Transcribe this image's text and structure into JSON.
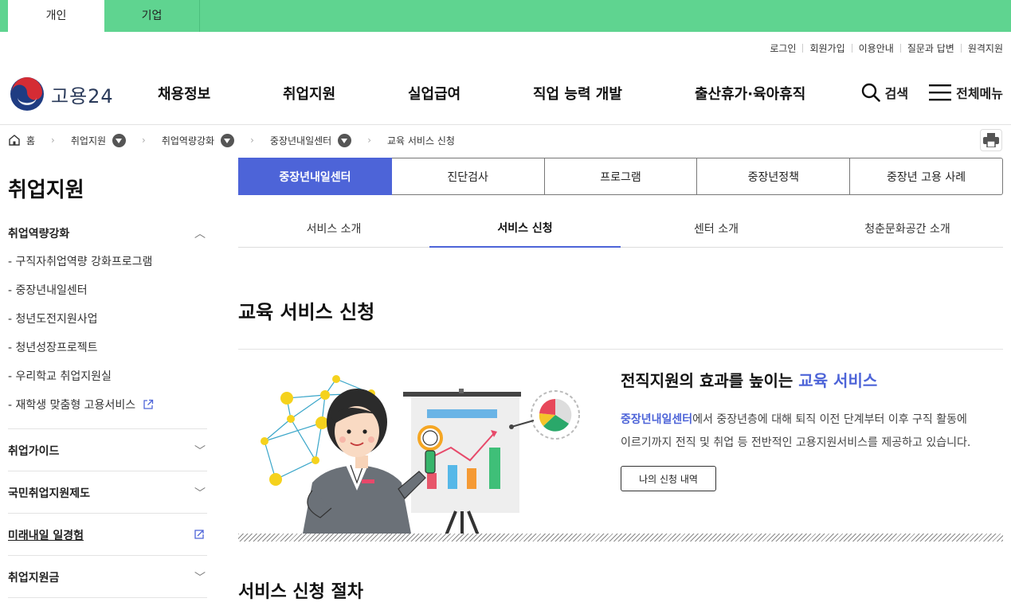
{
  "topbar": {
    "tabs": [
      "개인",
      "기업"
    ]
  },
  "util_links": [
    "로그인",
    "회원가입",
    "이용안내",
    "질문과 답변",
    "원격지원"
  ],
  "logo": {
    "text": "고용24"
  },
  "gnb": [
    "채용정보",
    "취업지원",
    "실업급여",
    "직업 능력 개발",
    "출산휴가·육아휴직"
  ],
  "header_actions": {
    "search": "검색",
    "menu": "전체메뉴"
  },
  "breadcrumb": [
    "홈",
    "취업지원",
    "취업역량강화",
    "중장년내일센터",
    "교육 서비스 신청"
  ],
  "sidebar": {
    "title": "취업지원",
    "section1": "취업역량강화",
    "items": [
      "- 구직자취업역량 강화프로그램",
      "- 중장년내일센터",
      "- 청년도전지원사업",
      "- 청년성장프로젝트",
      "- 우리학교 취업지원실",
      "- 재학생 맞춤형 고용서비스"
    ],
    "sections": [
      "취업가이드",
      "국민취업지원제도",
      "미래내일 일경험",
      "취업지원금"
    ]
  },
  "tabs_primary": [
    "중장년내일센터",
    "진단검사",
    "프로그램",
    "중장년정책",
    "중장년 고용 사례"
  ],
  "tabs_secondary": [
    "서비스 소개",
    "서비스 신청",
    "센터 소개",
    "청춘문화공간 소개"
  ],
  "page_title": "교육 서비스 신청",
  "promo": {
    "heading": "전직지원의 효과를 높이는 ",
    "heading_accent": "교육 서비스",
    "body_link": "중장년내일센터",
    "body_line1": "에서 중장년층에 대해 퇴직 이전 단계부터 이후 구직 활동에",
    "body_line2": "이르기까지 전직 및 취업 등 전반적인 고용지원서비스를 제공하고 있습니다.",
    "button": "나의 신청 내역"
  },
  "section_title": "서비스 신청 절차",
  "colors": {
    "green": "#5fd490",
    "accent": "#4d64d8"
  }
}
